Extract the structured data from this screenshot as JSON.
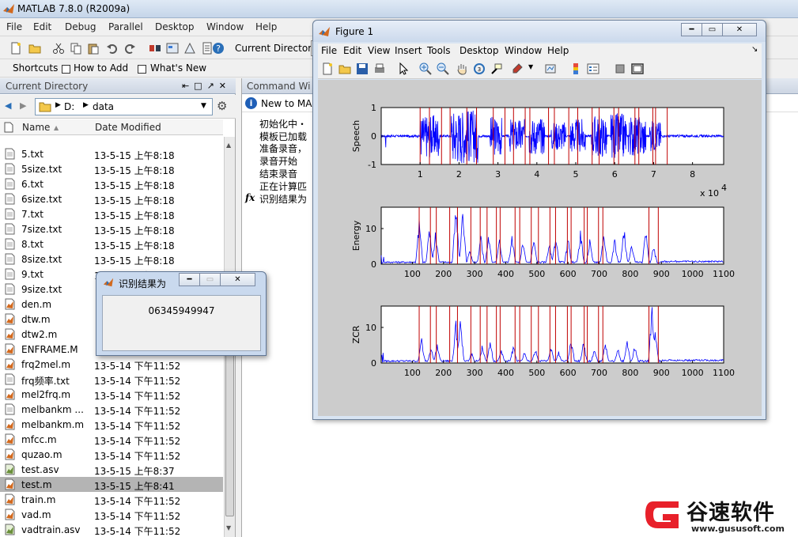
{
  "matlab": {
    "title": "MATLAB  7.8.0 (R2009a)",
    "menu": [
      "File",
      "Edit",
      "Debug",
      "Parallel",
      "Desktop",
      "Window",
      "Help"
    ],
    "toolbar": {
      "current_directory_label": "Current Directory"
    },
    "shortcuts": [
      "Shortcuts",
      "How to Add",
      "What's New"
    ]
  },
  "current_directory": {
    "title": "Current Directory",
    "path": [
      "D:",
      "data"
    ],
    "columns": {
      "name": "Name",
      "date": "Date Modified"
    },
    "files": [
      {
        "name": "5.txt",
        "date": "13-5-15 上午8:18",
        "type": "txt"
      },
      {
        "name": "5size.txt",
        "date": "13-5-15 上午8:18",
        "type": "txt"
      },
      {
        "name": "6.txt",
        "date": "13-5-15 上午8:18",
        "type": "txt"
      },
      {
        "name": "6size.txt",
        "date": "13-5-15 上午8:18",
        "type": "txt"
      },
      {
        "name": "7.txt",
        "date": "13-5-15 上午8:18",
        "type": "txt"
      },
      {
        "name": "7size.txt",
        "date": "13-5-15 上午8:18",
        "type": "txt"
      },
      {
        "name": "8.txt",
        "date": "13-5-15 上午8:18",
        "type": "txt"
      },
      {
        "name": "8size.txt",
        "date": "13-5-15 上午8:18",
        "type": "txt"
      },
      {
        "name": "9.txt",
        "date": "13-5-15 上午8:18",
        "type": "txt"
      },
      {
        "name": "9size.txt",
        "date": "",
        "type": "txt"
      },
      {
        "name": "den.m",
        "date": "",
        "type": "m"
      },
      {
        "name": "dtw.m",
        "date": "",
        "type": "m"
      },
      {
        "name": "dtw2.m",
        "date": "",
        "type": "m"
      },
      {
        "name": "ENFRAME.M",
        "date": "",
        "type": "m"
      },
      {
        "name": "frq2mel.m",
        "date": "13-5-14 下午11:52",
        "type": "m"
      },
      {
        "name": "frq频率.txt",
        "date": "13-5-14 下午11:52",
        "type": "txt"
      },
      {
        "name": "mel2frq.m",
        "date": "13-5-14 下午11:52",
        "type": "m"
      },
      {
        "name": "melbankm ...",
        "date": "13-5-14 下午11:52",
        "type": "txt"
      },
      {
        "name": "melbankm.m",
        "date": "13-5-14 下午11:52",
        "type": "m"
      },
      {
        "name": "mfcc.m",
        "date": "13-5-14 下午11:52",
        "type": "m"
      },
      {
        "name": "quzao.m",
        "date": "13-5-14 下午11:52",
        "type": "m"
      },
      {
        "name": "test.asv",
        "date": "13-5-15 上午8:37",
        "type": "asv"
      },
      {
        "name": "test.m",
        "date": "13-5-15 上午8:41",
        "type": "m",
        "selected": true
      },
      {
        "name": "train.m",
        "date": "13-5-14 下午11:52",
        "type": "m"
      },
      {
        "name": "vad.m",
        "date": "13-5-14 下午11:52",
        "type": "m"
      },
      {
        "name": "vadtrain.asv",
        "date": "13-5-14 下午11:52",
        "type": "asv"
      }
    ]
  },
  "command_window": {
    "title": "Command Wi",
    "new_to": "New to MA",
    "lines": [
      "初始化中・",
      "模板已加载",
      "准备录音，",
      "录音开始",
      "结束录音",
      "正在计算匹",
      "识别结果为"
    ],
    "prompt": "fx"
  },
  "figure": {
    "title": "Figure 1",
    "menu": [
      "File",
      "Edit",
      "View",
      "Insert",
      "Tools",
      "Desktop",
      "Window",
      "Help"
    ]
  },
  "dialog": {
    "title": "识别结果为",
    "message": "06345949947"
  },
  "watermark": {
    "text": "谷速软件",
    "url": "www.gususoft.com"
  },
  "chart_data": [
    {
      "type": "line",
      "ylabel": "Speech",
      "xlabel": "",
      "xlim": [
        0,
        88000
      ],
      "ylim": [
        -1,
        1
      ],
      "x_ticks": [
        1,
        2,
        3,
        4,
        5,
        6,
        7,
        8
      ],
      "x_tick_labels": [
        "1",
        "2",
        "3",
        "4",
        "5",
        "6",
        "7",
        "8"
      ],
      "y_ticks": [
        -1,
        0,
        1
      ],
      "y_tick_labels": [
        "-1",
        "0",
        "1"
      ],
      "x_multiplier": "x 10",
      "x_multiplier_exp": "4",
      "segments": [
        [
          1000,
          1500,
          0.75
        ],
        [
          1800,
          2500,
          0.95
        ],
        [
          2800,
          3100,
          0.7
        ],
        [
          3300,
          3700,
          0.6
        ],
        [
          3800,
          4200,
          0.65
        ],
        [
          4350,
          4750,
          0.5
        ],
        [
          4850,
          5250,
          0.6
        ],
        [
          5400,
          5800,
          0.75
        ],
        [
          5900,
          6300,
          0.8
        ],
        [
          6350,
          6800,
          0.7
        ],
        [
          6900,
          7200,
          0.55
        ]
      ],
      "boundaries_x1e4": [
        1.0,
        1.24,
        1.55,
        1.77,
        2.2,
        2.45,
        2.88,
        3.18,
        3.4,
        3.7,
        3.82,
        4.3,
        4.45,
        4.82,
        5.05,
        5.42,
        5.6,
        5.98,
        6.1,
        6.52,
        6.62,
        6.98,
        7.05,
        7.35
      ]
    },
    {
      "type": "line",
      "ylabel": "Energy",
      "xlabel": "",
      "xlim": [
        0,
        1100
      ],
      "ylim": [
        0,
        16
      ],
      "x_ticks": [
        100,
        200,
        300,
        400,
        500,
        600,
        700,
        800,
        900,
        1000,
        1100
      ],
      "x_tick_labels": [
        "100",
        "200",
        "300",
        "400",
        "500",
        "600",
        "700",
        "800",
        "900",
        "1000",
        "1100"
      ],
      "y_ticks": [
        0,
        10
      ],
      "y_tick_labels": [
        "0",
        "10"
      ],
      "peaks": [
        [
          122,
          12
        ],
        [
          155,
          10
        ],
        [
          175,
          9
        ],
        [
          240,
          16
        ],
        [
          262,
          15
        ],
        [
          285,
          4
        ],
        [
          320,
          8
        ],
        [
          345,
          9
        ],
        [
          380,
          7
        ],
        [
          420,
          8
        ],
        [
          455,
          6
        ],
        [
          490,
          7
        ],
        [
          540,
          6
        ],
        [
          560,
          8
        ],
        [
          600,
          7
        ],
        [
          640,
          9
        ],
        [
          670,
          7
        ],
        [
          715,
          9
        ],
        [
          750,
          7
        ],
        [
          780,
          10
        ],
        [
          805,
          6
        ],
        [
          850,
          9
        ],
        [
          875,
          5
        ]
      ],
      "boundaries": [
        122,
        158,
        177,
        220,
        245,
        288,
        318,
        340,
        370,
        382,
        430,
        445,
        482,
        505,
        542,
        560,
        598,
        610,
        652,
        662,
        698,
        712,
        860,
        890
      ]
    },
    {
      "type": "line",
      "ylabel": "ZCR",
      "xlabel": "",
      "xlim": [
        0,
        1100
      ],
      "ylim": [
        0,
        16
      ],
      "x_ticks": [
        100,
        200,
        300,
        400,
        500,
        600,
        700,
        800,
        900,
        1000,
        1100
      ],
      "x_tick_labels": [
        "100",
        "200",
        "300",
        "400",
        "500",
        "600",
        "700",
        "800",
        "900",
        "1000",
        "1100"
      ],
      "y_ticks": [
        0,
        10
      ],
      "y_tick_labels": [
        "0",
        "10"
      ],
      "peaks": [
        [
          130,
          7
        ],
        [
          160,
          4
        ],
        [
          180,
          6
        ],
        [
          240,
          11
        ],
        [
          255,
          12
        ],
        [
          290,
          3
        ],
        [
          325,
          5
        ],
        [
          350,
          6
        ],
        [
          385,
          4
        ],
        [
          425,
          5
        ],
        [
          460,
          3
        ],
        [
          495,
          4
        ],
        [
          545,
          5
        ],
        [
          570,
          3
        ],
        [
          610,
          7
        ],
        [
          650,
          6
        ],
        [
          685,
          4
        ],
        [
          720,
          6
        ],
        [
          760,
          4
        ],
        [
          790,
          6
        ],
        [
          815,
          5
        ],
        [
          870,
          16
        ],
        [
          880,
          10
        ]
      ],
      "boundaries": [
        122,
        158,
        177,
        220,
        245,
        288,
        318,
        340,
        370,
        382,
        430,
        445,
        482,
        505,
        542,
        560,
        598,
        610,
        652,
        662,
        698,
        712,
        860,
        890
      ]
    }
  ]
}
